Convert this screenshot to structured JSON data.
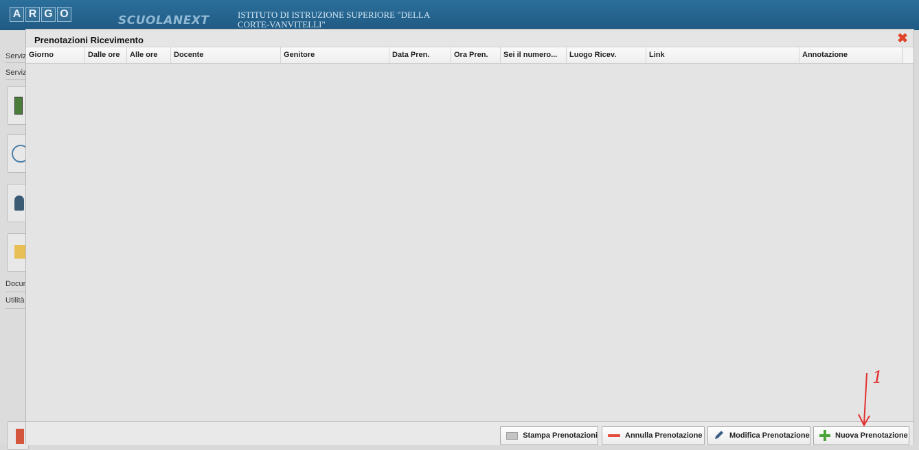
{
  "header": {
    "logo_letters": [
      "A",
      "R",
      "G",
      "O"
    ],
    "product": "SCUOLANEXT",
    "institute": "ISTITUTO DI ISTRUZIONE SUPERIORE \"DELLA CORTE-VANVITELLI\""
  },
  "sidebar": {
    "items": [
      "Serviz",
      "Serviz",
      "Docum",
      "Utilità"
    ]
  },
  "modal": {
    "title": "Prenotazioni Ricevimento",
    "close_icon": "close-icon",
    "columns": [
      "Giorno",
      "Dalle ore",
      "Alle ore",
      "Docente",
      "Genitore",
      "Data Pren.",
      "Ora Pren.",
      "Sei il numero...",
      "Luogo Ricev.",
      "Link",
      "Annotazione"
    ],
    "rows": [],
    "buttons": {
      "print": "Stampa Prenotazioni",
      "cancel": "Annulla Prenotazione",
      "edit": "Modifica Prenotazione",
      "new": "Nuova Prenotazione"
    }
  },
  "annotation": {
    "number": "1",
    "color": "#e23030"
  },
  "colors": {
    "header": "#1f5a83",
    "close": "#e0452a",
    "plus": "#4aa63a",
    "minus": "#e74c3c"
  }
}
